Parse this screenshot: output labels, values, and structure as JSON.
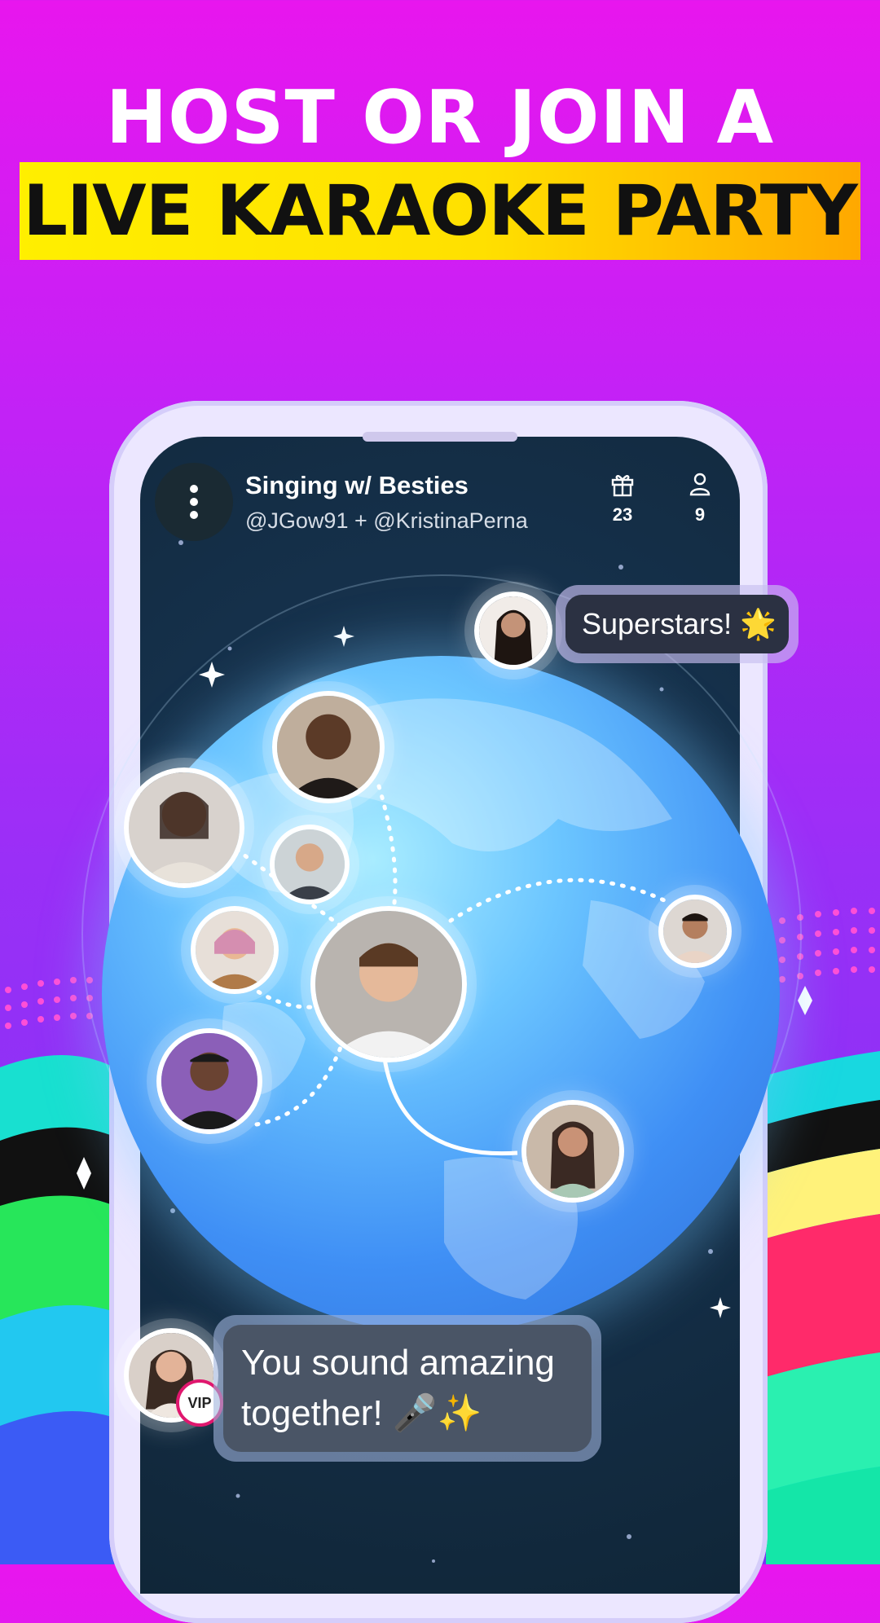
{
  "headline": {
    "line1": "HOST OR JOIN A",
    "line2": "LIVE KARAOKE PARTY"
  },
  "colors": {
    "background_top": "#e816ee",
    "background_bottom": "#7a35f2",
    "banner_yellow": "#ffef00",
    "banner_orange": "#ffa800",
    "screen_dark": "#15304a",
    "globe_blue": "#3f8ff5",
    "vip_ring": "#e0176e"
  },
  "room": {
    "title": "Singing w/ Besties",
    "hosts": "@JGow91 + @KristinaPerna",
    "menu_icon": "more-vertical-icon",
    "gifts": {
      "icon": "gift-icon",
      "count": "23"
    },
    "listeners": {
      "icon": "person-icon",
      "count": "9"
    }
  },
  "comments": [
    {
      "text": "Superstars! 🌟"
    },
    {
      "text_line1": "You sound amazing",
      "text_line2": "together! 🎤✨",
      "badge": "VIP"
    }
  ]
}
